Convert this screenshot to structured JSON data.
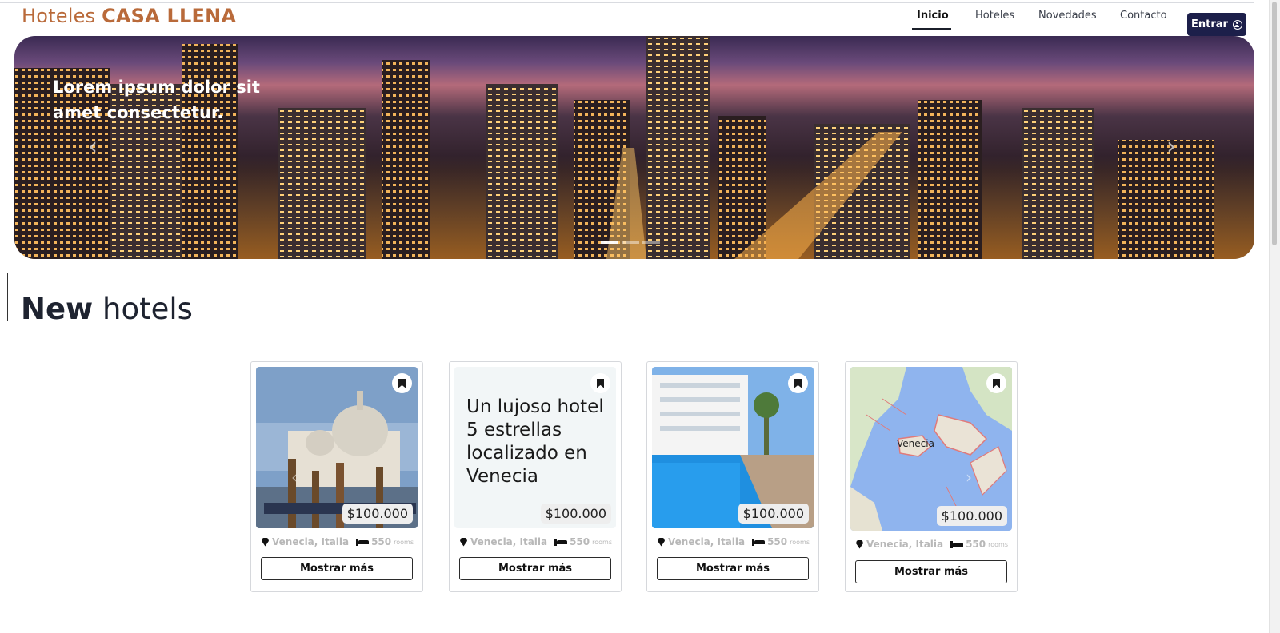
{
  "header": {
    "brand_light": "Hoteles",
    "brand_bold": "CASA LLENA",
    "nav": [
      {
        "label": "Inicio",
        "active": true
      },
      {
        "label": "Hoteles",
        "active": false
      },
      {
        "label": "Novedades",
        "active": false
      },
      {
        "label": "Contacto",
        "active": false
      }
    ],
    "login_label": "Entrar",
    "login_icon": "user-circle-icon"
  },
  "hero": {
    "heading": "Lorem ipsum dolor sit amet consectetur.",
    "slides_total": 3,
    "active_slide": 1
  },
  "section": {
    "title_bold": "New",
    "title_light": "hotels"
  },
  "colors": {
    "brand": "#b96a3a",
    "login_bg": "#1c1f4a",
    "price_bg": "#eeeeee"
  },
  "cards": [
    {
      "media": "venice-basilica-photo",
      "description": "",
      "price": "$100.000",
      "location": "Venecia, Italia",
      "rooms": "550",
      "rooms_unit": "rooms",
      "button": "Mostrar más"
    },
    {
      "media": "text",
      "description": "Un lujoso hotel 5 estrellas localizado en Venecia",
      "price": "$100.000",
      "location": "Venecia, Italia",
      "rooms": "550",
      "rooms_unit": "rooms",
      "button": "Mostrar más"
    },
    {
      "media": "hotel-pool-photo",
      "description": "",
      "price": "$100.000",
      "location": "Venecia, Italia",
      "rooms": "550",
      "rooms_unit": "rooms",
      "button": "Mostrar más"
    },
    {
      "media": "venice-map",
      "map_label": "Venecia",
      "price": "$100.000",
      "location": "Venecia, Italia",
      "rooms": "550",
      "rooms_unit": "rooms",
      "button": "Mostrar más"
    }
  ]
}
